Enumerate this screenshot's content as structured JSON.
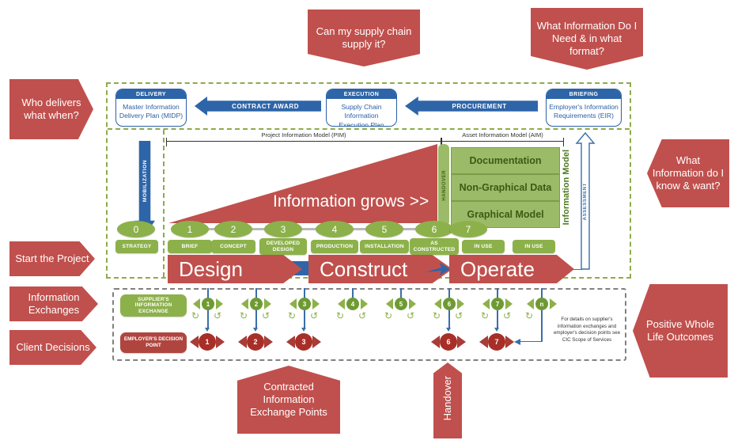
{
  "callouts": {
    "who_delivers": "Who delivers what when?",
    "supply_chain": "Can my supply chain supply it?",
    "what_info_need": "What Information Do I Need & in what format?",
    "what_info_know": "What Information do I know & want?",
    "start_project": "Start the Project",
    "information_exchanges": "Information Exchanges",
    "client_decisions": "Client Decisions",
    "positive_outcomes": "Positive Whole Life Outcomes",
    "contracted_points": "Contracted Information Exchange Points",
    "handover": "Handover"
  },
  "plan_boxes": [
    {
      "header": "DELIVERY",
      "body": "Master Information Delivery Plan (MIDP)"
    },
    {
      "header": "EXECUTION",
      "body": "Supply Chain Information Execution Plan (SCIEP)"
    },
    {
      "header": "BRIEFING",
      "body": "Employer's Information Requirements (EIR)"
    }
  ],
  "flow_arrows": {
    "contract_award": "CONTRACT AWARD",
    "procurement": "PROCUREMENT",
    "mobilization": "MOBILIZATION",
    "assessment": "ASSESSMENT"
  },
  "brackets": {
    "pim": "Project Information Model (PIM)",
    "aim": "Asset Information Model (AIM)"
  },
  "triangle_label": "Information grows >>",
  "information_model": {
    "title": "Information Model",
    "handover": "HANDOVER",
    "layers": [
      "Documentation",
      "Non-Graphical Data",
      "Graphical Model"
    ]
  },
  "stages": [
    {
      "number": "0",
      "label": "STRATEGY"
    },
    {
      "number": "1",
      "label": "BRIEF"
    },
    {
      "number": "2",
      "label": "CONCEPT"
    },
    {
      "number": "3",
      "label": "DEVELOPED DESIGN"
    },
    {
      "number": "4",
      "label": "PRODUCTION"
    },
    {
      "number": "5",
      "label": "INSTALLATION"
    },
    {
      "number": "6",
      "label": "AS CONSTRUCTED"
    },
    {
      "number": "7",
      "label": "IN USE"
    },
    {
      "number": "",
      "label": "IN USE"
    }
  ],
  "phases": [
    "Design",
    "Construct",
    "Operate"
  ],
  "exchange_section": {
    "supplier_label": "SUPPLIER'S INFORMATION EXCHANGE",
    "employer_label": "EMPLOYER'S DECISION POINT",
    "supplier_points": [
      "1",
      "2",
      "3",
      "4",
      "5",
      "6",
      "7",
      "n"
    ],
    "employer_points": [
      "1",
      "2",
      "3",
      "6",
      "7"
    ],
    "note": "For details on supplier's information exchanges and employer's decision points see CIC Scope of Services"
  },
  "colors": {
    "red": "#c0504d",
    "blue": "#2e65a8",
    "green": "#8cb14a",
    "green_dash": "#8faa4a",
    "panel_green": "#9cbb68"
  }
}
